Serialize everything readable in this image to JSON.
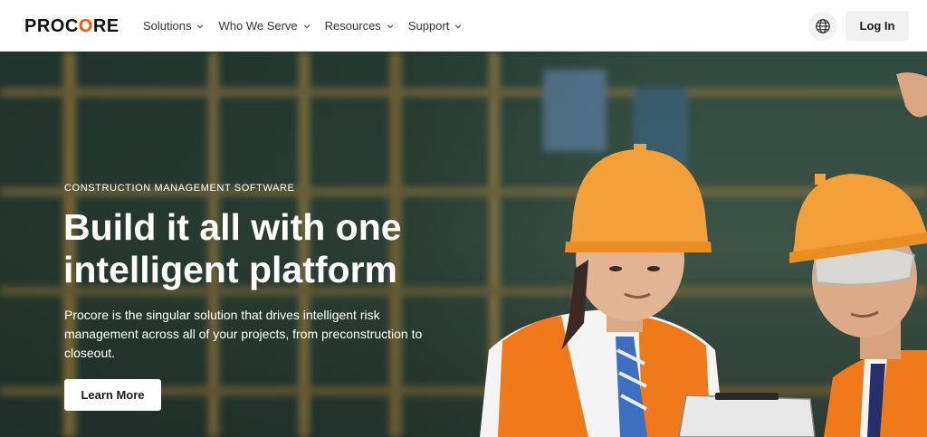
{
  "header": {
    "logo_text_pre": "PROC",
    "logo_text_o": "O",
    "logo_text_post": "RE",
    "nav": [
      {
        "label": "Solutions",
        "icon": "chevron-down-icon"
      },
      {
        "label": "Who We Serve",
        "icon": "chevron-down-icon"
      },
      {
        "label": "Resources",
        "icon": "chevron-down-icon"
      },
      {
        "label": "Support",
        "icon": "chevron-down-icon"
      }
    ],
    "language_icon": "globe-icon",
    "login_label": "Log In"
  },
  "hero": {
    "eyebrow": "CONSTRUCTION MANAGEMENT SOFTWARE",
    "headline": "Build it all with one intelligent platform",
    "subcopy": "Procore is the singular solution that drives intelligent risk management across all of your projects, from preconstruction to closeout.",
    "cta_label": "Learn More",
    "image": "construction-workers-photo"
  },
  "colors": {
    "brand_orange": "#ff5200",
    "header_bg": "#ffffff",
    "button_bg": "#f0f0f0",
    "hero_text": "#ffffff"
  }
}
